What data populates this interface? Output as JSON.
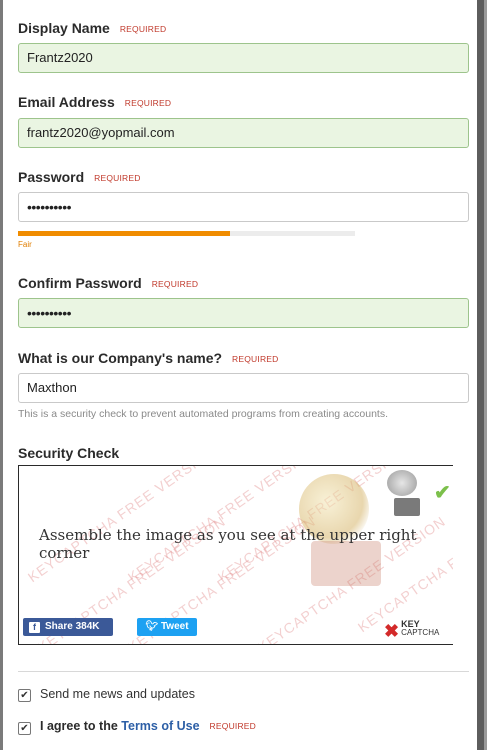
{
  "form": {
    "required_tag": "REQUIRED",
    "display_name": {
      "label": "Display Name",
      "value": "Frantz2020"
    },
    "email": {
      "label": "Email Address",
      "value": "frantz2020@yopmail.com"
    },
    "password": {
      "label": "Password",
      "value": "••••••••••",
      "strength_label": "Fair",
      "strength_fraction": 0.63
    },
    "confirm_password": {
      "label": "Confirm Password",
      "value": "••••••••••"
    },
    "company_question": {
      "label": "What is our Company's name?",
      "value": "Maxthon",
      "help": "This is a security check to prevent automated programs from creating accounts."
    }
  },
  "security_check": {
    "label": "Security Check",
    "instruction": "Assemble the image as you see at the upper right corner",
    "watermark": "KEYCAPTCHA FREE VERSION",
    "share_label": "Share 384K",
    "tweet_label": "Tweet",
    "logo_line1": "KEY",
    "logo_line2": "CAPTCHA"
  },
  "checkboxes": {
    "news": {
      "label": "Send me news and updates",
      "checked": true
    },
    "terms": {
      "prefix": "I agree to the ",
      "link": "Terms of Use",
      "checked": true
    }
  },
  "colors": {
    "valid_bg": "#eaf5e2",
    "required": "#c0392b",
    "strength": "#f08c00",
    "link": "#2d5fa6"
  }
}
